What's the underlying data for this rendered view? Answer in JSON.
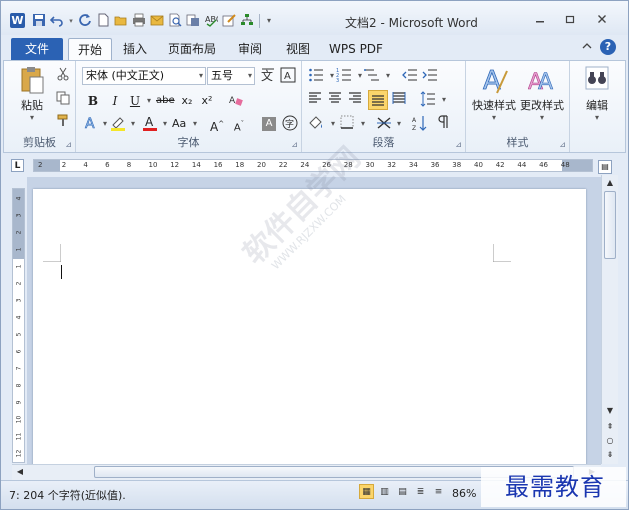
{
  "window": {
    "title": "文档2 - Microsoft Word",
    "app_icon_letter": "W"
  },
  "quick_access": [
    "save-icon",
    "undo-icon",
    "redo-icon",
    "new-icon",
    "open-icon",
    "print-icon",
    "print-preview-icon",
    "spelling-icon",
    "edit-icon",
    "structure-icon"
  ],
  "tabs": {
    "file": "文件",
    "items": [
      "开始",
      "插入",
      "页面布局",
      "审阅",
      "视图",
      "WPS PDF"
    ],
    "active": "开始"
  },
  "ribbon": {
    "clipboard": {
      "paste": "粘贴",
      "label": "剪贴板"
    },
    "font": {
      "name": "宋体 (中文正文)",
      "size": "五号",
      "label": "字体",
      "bold": "B",
      "italic": "I",
      "underline": "U",
      "strike": "abe",
      "sub": "x₂",
      "sup": "x²",
      "case": "Aa",
      "grow": "A",
      "shrink": "A",
      "shade": "A",
      "enclose": "字"
    },
    "paragraph": {
      "label": "段落"
    },
    "styles": {
      "quick": "快速样式",
      "change": "更改样式",
      "label": "样式"
    },
    "editing": {
      "label": "编辑"
    }
  },
  "ruler": {
    "corner": "L",
    "h_ticks": [
      "2",
      "2",
      "4",
      "6",
      "8",
      "10",
      "12",
      "14",
      "16",
      "18",
      "20",
      "22",
      "24",
      "26",
      "28",
      "30",
      "32",
      "34",
      "36",
      "38",
      "40",
      "42",
      "44",
      "46",
      "48"
    ],
    "v_ticks": [
      "4",
      "3",
      "2",
      "1",
      "1",
      "2",
      "3",
      "4",
      "5",
      "6",
      "7",
      "8",
      "9",
      "10",
      "11",
      "12"
    ]
  },
  "status": {
    "words": "7: 204 个字符(近似值).",
    "zoom": "86%"
  },
  "watermark": {
    "text": "软件自学网",
    "url": "WWW.RJZXW.COM"
  },
  "corner_brand": "最需教育",
  "colors": {
    "file_tab": "#2b62b4",
    "active_toggle": "#fbd56b",
    "doc_bg": "#c6d3e6"
  }
}
